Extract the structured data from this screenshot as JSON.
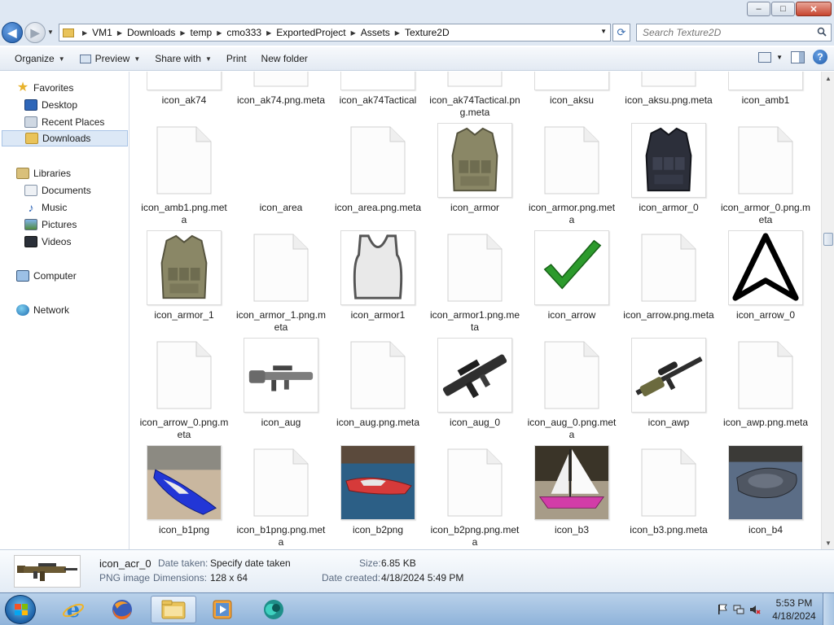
{
  "window": {
    "min_label": "–",
    "max_label": "□",
    "close_label": "✕"
  },
  "address": {
    "crumbs": [
      "VM1",
      "Downloads",
      "temp",
      "cmo333",
      "ExportedProject",
      "Assets",
      "Texture2D"
    ],
    "refresh_icon": "refresh-icon"
  },
  "search": {
    "placeholder": "Search Texture2D"
  },
  "toolbar": {
    "organize": "Organize",
    "preview": "Preview",
    "share_with": "Share with",
    "print": "Print",
    "new_folder": "New folder",
    "help": "?"
  },
  "nav": {
    "favorites": "Favorites",
    "desktop": "Desktop",
    "recent_places": "Recent Places",
    "downloads": "Downloads",
    "libraries": "Libraries",
    "documents": "Documents",
    "music": "Music",
    "pictures": "Pictures",
    "videos": "Videos",
    "computer": "Computer",
    "network": "Network"
  },
  "files": [
    {
      "name": "icon_ak74",
      "kind": "gun"
    },
    {
      "name": "icon_ak74.png.meta",
      "kind": "doc"
    },
    {
      "name": "icon_ak74Tactical",
      "kind": "gun"
    },
    {
      "name": "icon_ak74Tactical.png.meta",
      "kind": "doc"
    },
    {
      "name": "icon_aksu",
      "kind": "gun"
    },
    {
      "name": "icon_aksu.png.meta",
      "kind": "doc"
    },
    {
      "name": "icon_amb1",
      "kind": "dark"
    },
    {
      "name": "icon_amb1.png.meta",
      "kind": "doc"
    },
    {
      "name": "icon_area",
      "kind": "blank"
    },
    {
      "name": "icon_area.png.meta",
      "kind": "doc"
    },
    {
      "name": "icon_armor",
      "kind": "vest-tan"
    },
    {
      "name": "icon_armor.png.meta",
      "kind": "doc"
    },
    {
      "name": "icon_armor_0",
      "kind": "vest-dark"
    },
    {
      "name": "icon_armor_0.png.meta",
      "kind": "doc"
    },
    {
      "name": "icon_armor_1",
      "kind": "vest-tan"
    },
    {
      "name": "icon_armor_1.png.meta",
      "kind": "doc"
    },
    {
      "name": "icon_armor1",
      "kind": "vest-outline"
    },
    {
      "name": "icon_armor1.png.meta",
      "kind": "doc"
    },
    {
      "name": "icon_arrow",
      "kind": "check"
    },
    {
      "name": "icon_arrow.png.meta",
      "kind": "doc"
    },
    {
      "name": "icon_arrow_0",
      "kind": "arrow"
    },
    {
      "name": "icon_arrow_0.png.meta",
      "kind": "doc"
    },
    {
      "name": "icon_aug",
      "kind": "rifle"
    },
    {
      "name": "icon_aug.png.meta",
      "kind": "doc"
    },
    {
      "name": "icon_aug_0",
      "kind": "rifle-big"
    },
    {
      "name": "icon_aug_0.png.meta",
      "kind": "doc"
    },
    {
      "name": "icon_awp",
      "kind": "sniper"
    },
    {
      "name": "icon_awp.png.meta",
      "kind": "doc"
    },
    {
      "name": "icon_b1png",
      "kind": "boat-blue"
    },
    {
      "name": "icon_b1png.png.meta",
      "kind": "doc"
    },
    {
      "name": "icon_b2png",
      "kind": "boat-red"
    },
    {
      "name": "icon_b2png.png.meta",
      "kind": "doc"
    },
    {
      "name": "icon_b3",
      "kind": "sailboat"
    },
    {
      "name": "icon_b3.png.meta",
      "kind": "doc"
    },
    {
      "name": "icon_b4",
      "kind": "raft"
    }
  ],
  "details": {
    "name": "icon_acr_0",
    "type": "PNG image",
    "date_taken_label": "Date taken:",
    "date_taken_value": "Specify date taken",
    "dimensions_label": "Dimensions:",
    "dimensions_value": "128 x 64",
    "size_label": "Size:",
    "size_value": "6.85 KB",
    "date_created_label": "Date created:",
    "date_created_value": "4/18/2024 5:49 PM"
  },
  "taskbar": {
    "time": "5:53 PM",
    "date": "4/18/2024",
    "apps": [
      "internet-explorer-icon",
      "firefox-icon",
      "file-explorer-icon",
      "media-player-icon",
      "app-icon"
    ]
  }
}
